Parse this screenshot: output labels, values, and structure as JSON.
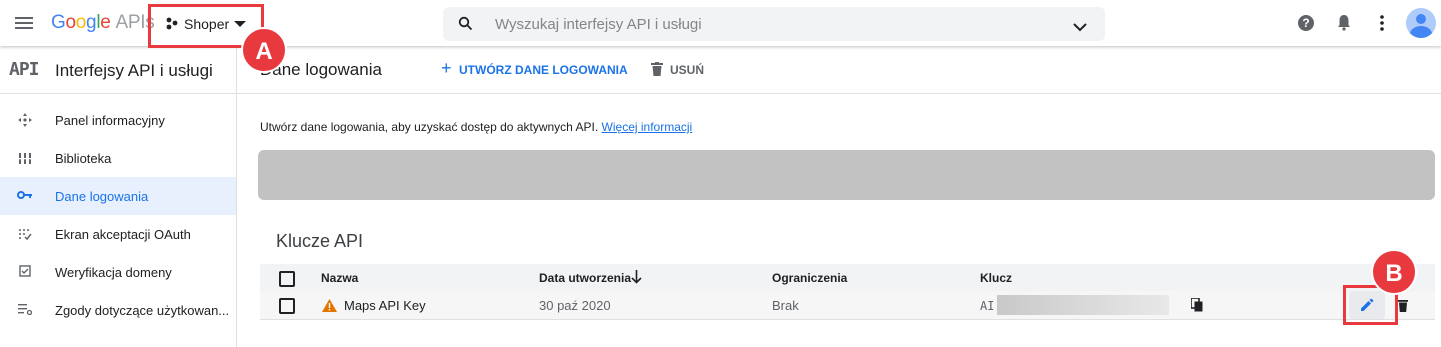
{
  "topbar": {
    "brand_google": "Google",
    "brand_apis": " APIs",
    "project_name": "Shoper",
    "search_placeholder": "Wyszukaj interfejsy API i usługi",
    "marker_a": "A"
  },
  "sidebar": {
    "logo_text": "API",
    "title": "Interfejsy API i usługi",
    "items": [
      {
        "label": "Panel informacyjny",
        "icon": "dashboard-icon"
      },
      {
        "label": "Biblioteka",
        "icon": "library-icon"
      },
      {
        "label": "Dane logowania",
        "icon": "key-icon"
      },
      {
        "label": "Ekran akceptacji OAuth",
        "icon": "oauth-icon"
      },
      {
        "label": "Weryfikacja domeny",
        "icon": "checkbox-icon"
      },
      {
        "label": "Zgody dotyczące użytkowan...",
        "icon": "settings-list-icon"
      }
    ]
  },
  "main": {
    "page_title": "Dane logowania",
    "create_button": "UTWÓRZ DANE LOGOWANIA",
    "delete_button": "USUŃ",
    "intro_text": "Utwórz dane logowania, aby uzyskać dostęp do aktywnych API.",
    "intro_link": "Więcej informacji",
    "section_title": "Klucze API",
    "columns": [
      "Nazwa",
      "Data utworzenia",
      "Ograniczenia",
      "Klucz"
    ],
    "rows": [
      {
        "name": "Maps API Key",
        "created": "30 paź 2020",
        "restrictions": "Brak",
        "key_prefix": "AI"
      }
    ],
    "marker_b": "B"
  },
  "colors": {
    "accent": "#1a73e8",
    "marker": "#e8393f",
    "warning": "#e37400"
  }
}
